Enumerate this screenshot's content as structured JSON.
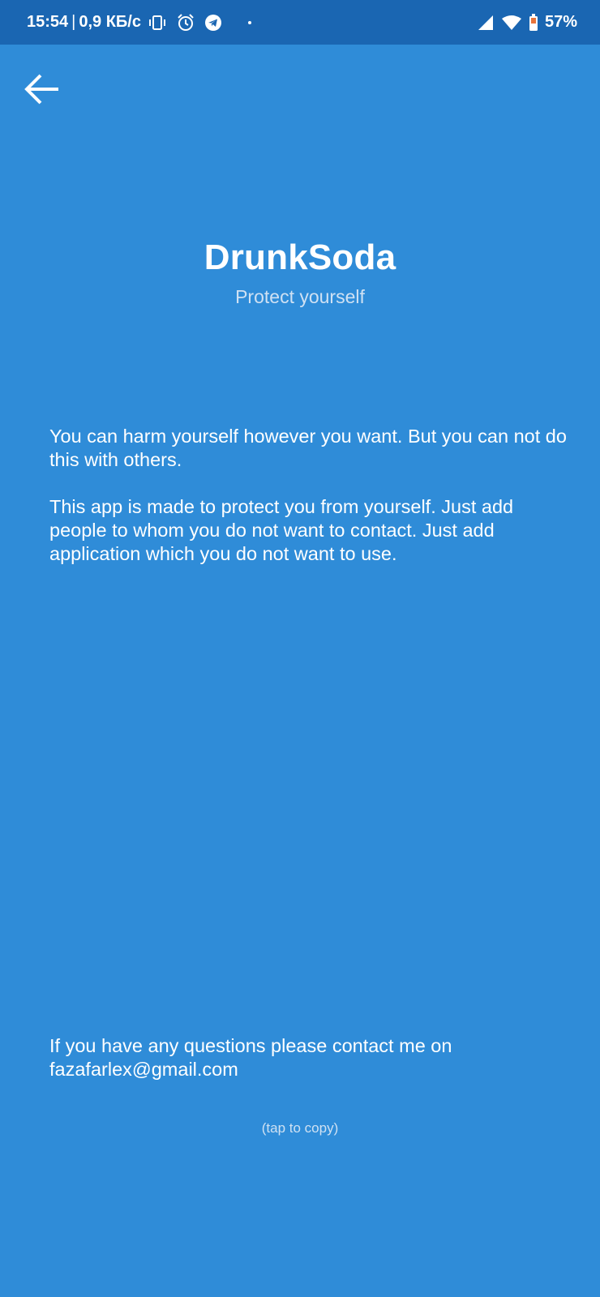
{
  "status_bar": {
    "time": "15:54",
    "separator": "|",
    "network_speed": "0,9 КБ/с",
    "battery_percent": "57%",
    "icons_left": [
      "vibrate-icon",
      "alarm-icon",
      "telegram-icon",
      "dot-icon"
    ],
    "icons_right": [
      "cell-signal-icon",
      "wifi-icon",
      "battery-icon"
    ],
    "background_color": "#1a66b2"
  },
  "toolbar": {
    "back_icon": "arrow-left-icon"
  },
  "header": {
    "title": "DrunkSoda",
    "subtitle": "Protect yourself"
  },
  "description": {
    "paragraphs": [
      "You can harm yourself however you want. But you can not do this with others.",
      "This app is made to protect you from yourself. Just add people to whom you do not want to contact. Just add application which you do not want to use."
    ]
  },
  "contact": {
    "text": "If you have any questions please contact me on",
    "email": "fazafarlex@gmail.com",
    "hint": "(tap to copy)"
  },
  "colors": {
    "background": "#2f8cd8",
    "status_bar": "#1a66b2",
    "text": "#ffffff",
    "muted_text": "#cfe1f3"
  }
}
